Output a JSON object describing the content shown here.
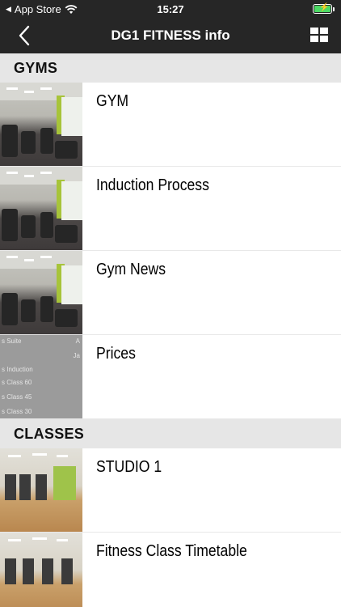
{
  "status_bar": {
    "carrier": "App Store",
    "time": "15:27"
  },
  "nav": {
    "title": "DG1 FITNESS info"
  },
  "sections": [
    {
      "header": "GYMS",
      "items": [
        {
          "label": "GYM"
        },
        {
          "label": "Induction Process"
        },
        {
          "label": "Gym News"
        },
        {
          "label": "Prices"
        }
      ]
    },
    {
      "header": "CLASSES",
      "items": [
        {
          "label": "STUDIO 1"
        },
        {
          "label": "Fitness Class Timetable"
        }
      ]
    }
  ],
  "prices_thumbnail_lines": [
    "s Suite",
    "s Induction",
    "s Class 60",
    "s Class 45",
    "s Class 30"
  ],
  "prices_thumbnail_right": [
    "A",
    "Ja"
  ],
  "colors": {
    "bar_background": "#262626",
    "section_background": "#e6e6e6",
    "battery": "#4cd964"
  }
}
